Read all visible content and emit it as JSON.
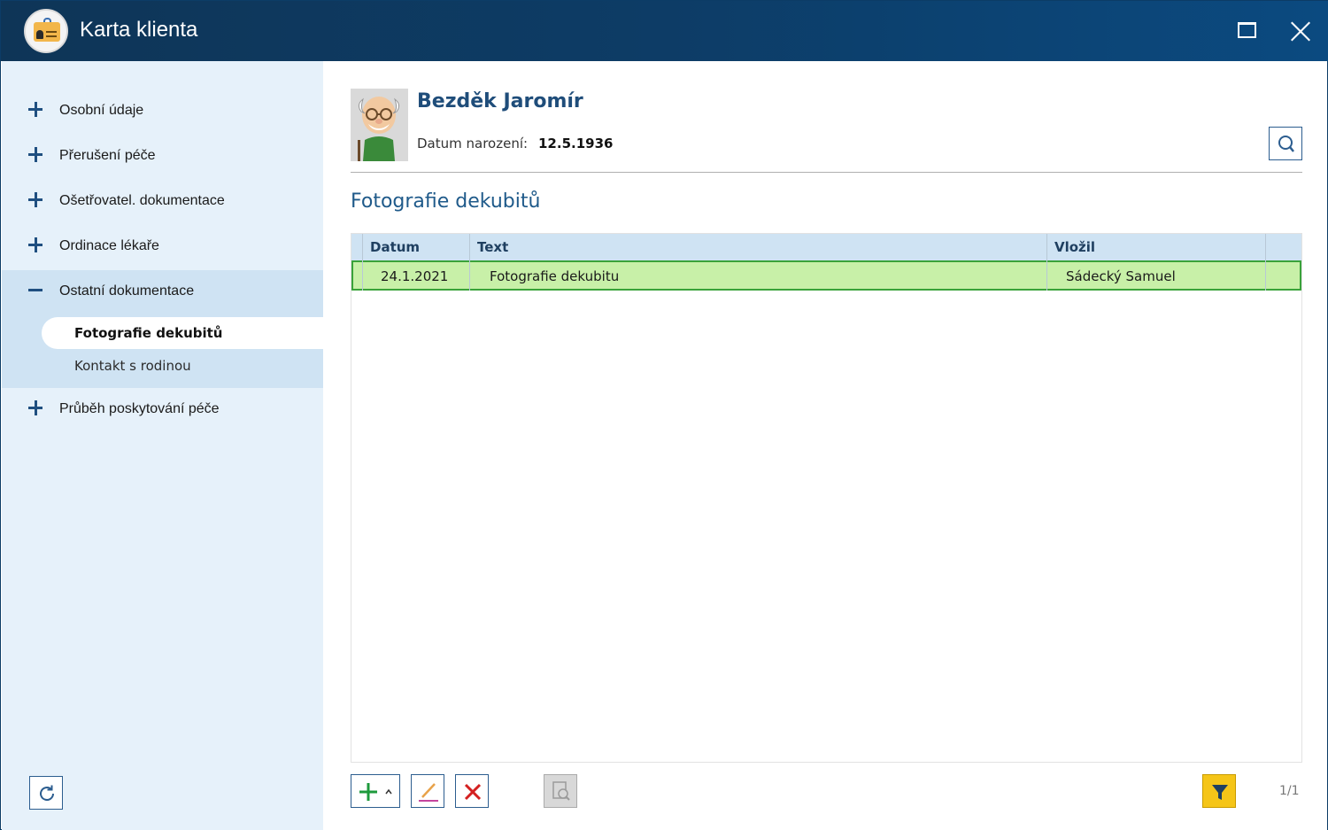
{
  "window": {
    "title": "Karta klienta"
  },
  "sidebar": {
    "items": [
      {
        "label": "Osobní údaje",
        "state": "collapsed"
      },
      {
        "label": "Přerušení péče",
        "state": "collapsed"
      },
      {
        "label": "Ošetřovatel. dokumentace",
        "state": "collapsed"
      },
      {
        "label": "Ordinace lékaře",
        "state": "collapsed"
      },
      {
        "label": "Ostatní dokumentace",
        "state": "expanded"
      },
      {
        "label": "Průběh poskytování péče",
        "state": "collapsed"
      }
    ],
    "sub_items": [
      {
        "label": "Fotografie dekubitů",
        "active": true
      },
      {
        "label": "Kontakt s rodinou",
        "active": false
      }
    ]
  },
  "patient": {
    "name": "Bezděk Jaromír",
    "dob_label": "Datum narození:",
    "dob_value": "12.5.1936"
  },
  "section": {
    "title": "Fotografie dekubitů"
  },
  "grid": {
    "columns": [
      "Datum",
      "Text",
      "Vložil"
    ],
    "rows": [
      {
        "date": "24.1.2021",
        "text": "Fotografie dekubitu",
        "author": "Sádecký Samuel",
        "selected": true
      }
    ]
  },
  "pager": {
    "text": "1/1"
  },
  "colors": {
    "titlebar": "#0d3c66",
    "sidebar_bg": "#e6f1fa",
    "selected_row": "#c8f0a8",
    "filter_button": "#f5c518"
  }
}
